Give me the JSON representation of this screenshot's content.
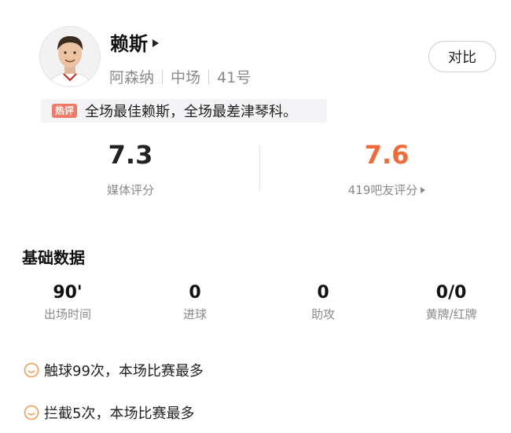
{
  "player": {
    "name": "赖斯",
    "club": "阿森纳",
    "position": "中场",
    "number": "41号"
  },
  "compare_button": "对比",
  "hot_comment": {
    "badge": "热评",
    "text": "全场最佳赖斯，全场最差津琴科。"
  },
  "ratings": {
    "media": {
      "value": "7.3",
      "label": "媒体评分"
    },
    "fans": {
      "value": "7.6",
      "label": "419吧友评分",
      "color": "#f06a3a"
    }
  },
  "basic_stats": {
    "title": "基础数据",
    "items": [
      {
        "value": "90'",
        "label": "出场时间"
      },
      {
        "value": "0",
        "label": "进球"
      },
      {
        "value": "0",
        "label": "助攻"
      },
      {
        "value": "0/0",
        "label": "黄牌/红牌"
      }
    ]
  },
  "highlights": [
    {
      "icon": "smile-icon",
      "text": "触球99次，本场比赛最多"
    },
    {
      "icon": "smile-icon",
      "text": "拦截5次，本场比赛最多"
    }
  ],
  "colors": {
    "accent": "#f06a3a",
    "badge": "#f07a66",
    "smile": "#f0a050"
  }
}
